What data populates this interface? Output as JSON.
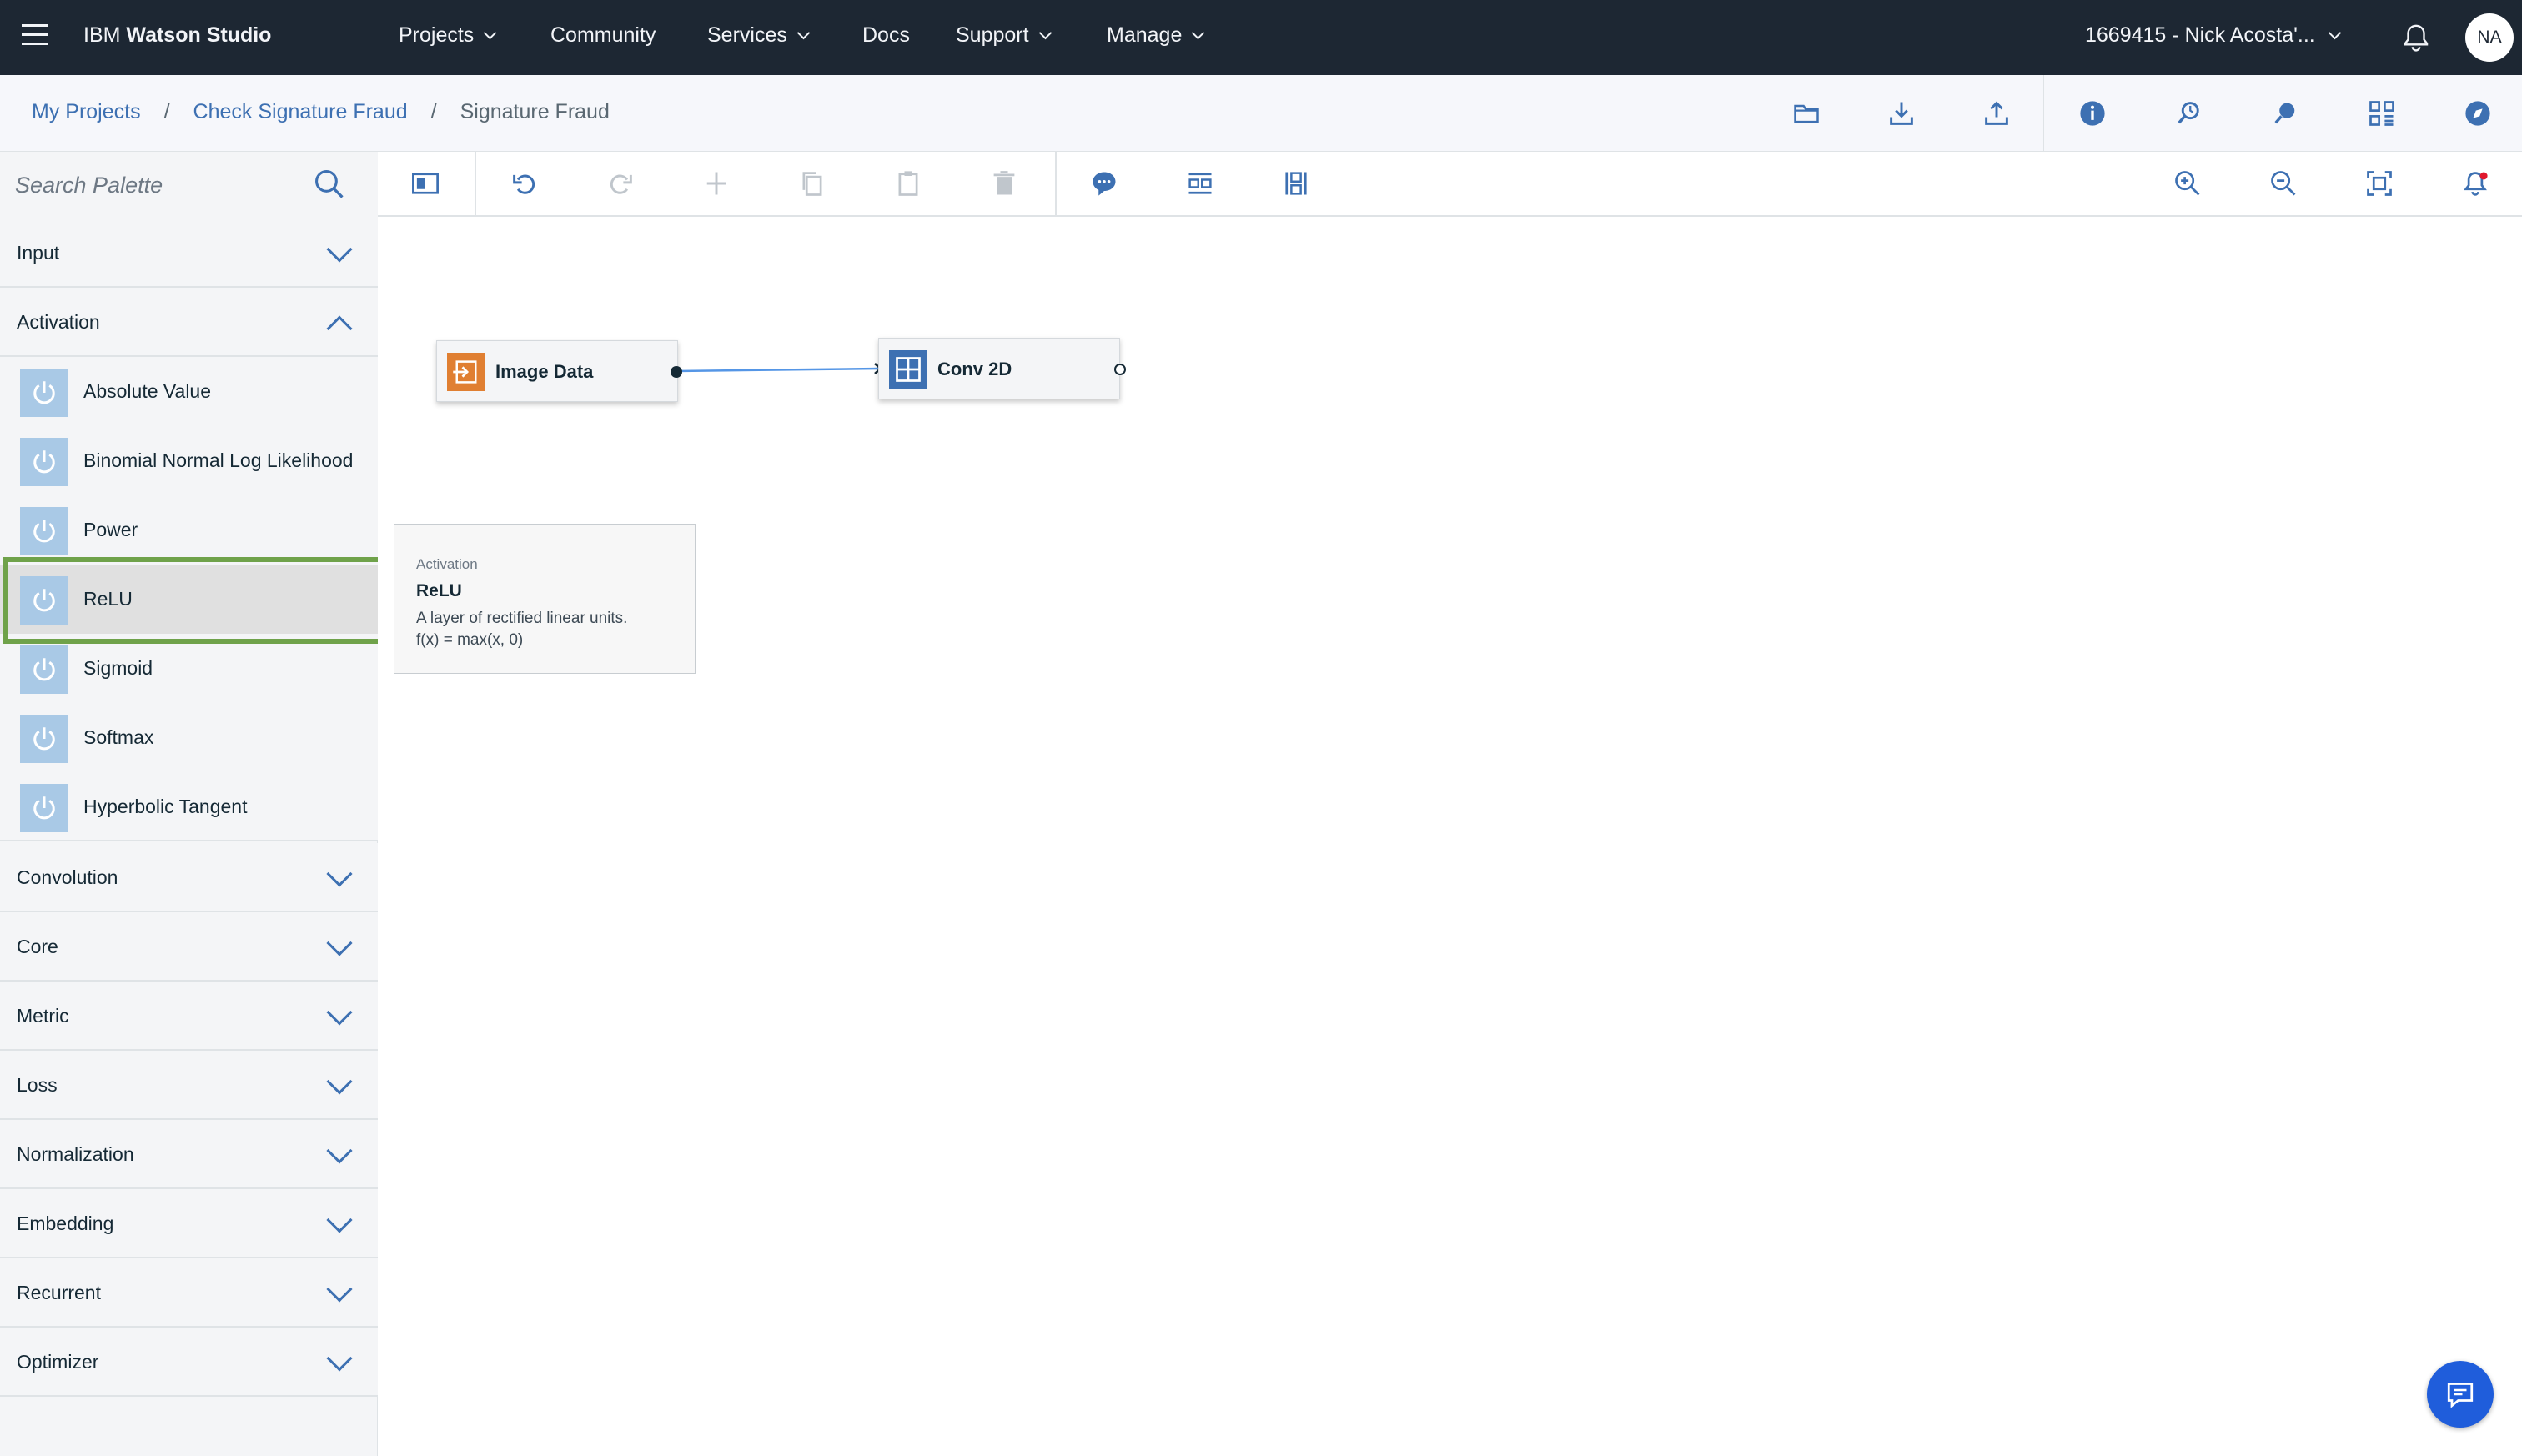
{
  "topnav": {
    "brand_prefix": "IBM",
    "brand_name": "Watson Studio",
    "items": [
      {
        "label": "Projects"
      },
      {
        "label": "Community"
      },
      {
        "label": "Services"
      },
      {
        "label": "Docs"
      },
      {
        "label": "Support"
      },
      {
        "label": "Manage"
      }
    ],
    "account": "1669415 - Nick Acosta'...",
    "avatar_initials": "NA"
  },
  "breadcrumb": {
    "items": [
      "My Projects",
      "Check Signature Fraud"
    ],
    "separator": "/",
    "current": "Signature Fraud"
  },
  "palette": {
    "search_placeholder": "Search Palette",
    "categories_top": [
      {
        "label": "Input"
      },
      {
        "label": "Activation"
      }
    ],
    "activation_items": [
      {
        "label": "Absolute Value"
      },
      {
        "label": "Binomial Normal Log Likelihood"
      },
      {
        "label": "Power"
      },
      {
        "label": "ReLU"
      },
      {
        "label": "Sigmoid"
      },
      {
        "label": "Softmax"
      },
      {
        "label": "Hyperbolic Tangent"
      }
    ],
    "categories_bottom": [
      {
        "label": "Convolution"
      },
      {
        "label": "Core"
      },
      {
        "label": "Metric"
      },
      {
        "label": "Loss"
      },
      {
        "label": "Normalization"
      },
      {
        "label": "Embedding"
      },
      {
        "label": "Recurrent"
      },
      {
        "label": "Optimizer"
      }
    ]
  },
  "canvas": {
    "nodes": [
      {
        "label": "Image Data",
        "icon": "input-icon",
        "color": "#e07f32"
      },
      {
        "label": "Conv 2D",
        "icon": "grid-icon",
        "color": "#3d70b2"
      }
    ]
  },
  "tooltip": {
    "category": "Activation",
    "name": "ReLU",
    "description_line1": "A layer of rectified linear units.",
    "description_line2": "f(x) = max(x, 0)"
  },
  "colors": {
    "topnav_bg": "#1d2733",
    "link": "#3d70b2",
    "highlight": "#6fa24a",
    "palette_icon_bg": "#a9c9e6",
    "chat_button": "#1f5ddb"
  }
}
